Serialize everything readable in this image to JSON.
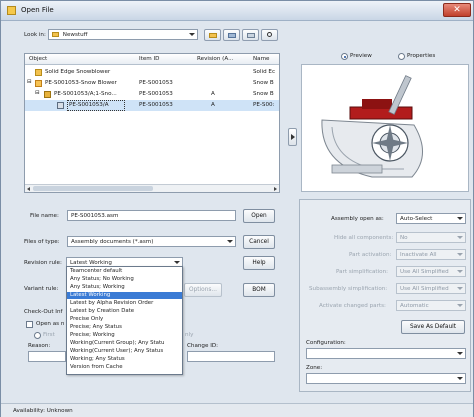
{
  "window": {
    "title": "Open File",
    "close_glyph": "✕"
  },
  "look_in": {
    "label": "Look in:",
    "value": "Newstuff"
  },
  "tree": {
    "columns": [
      "Object",
      "Item ID",
      "Revision (A...",
      "Name"
    ],
    "rows": [
      {
        "object": "Solid Edge Snowblower",
        "item_id": "",
        "revision": "",
        "name": "Solid Ec"
      },
      {
        "object": "PE-S001053-Snow Blower",
        "item_id": "PE-S001053",
        "revision": "",
        "name": "Snow B"
      },
      {
        "object": "PE-S001053/A;1-Sno...",
        "item_id": "PE-S001053",
        "revision": "A",
        "name": "Snow B"
      },
      {
        "object": "PE-S001053/A",
        "item_id": "PE-S001053",
        "revision": "A",
        "name": "PE-S00:"
      }
    ]
  },
  "view_mode": {
    "preview_label": "Preview",
    "properties_label": "Properties"
  },
  "file_name": {
    "label": "File name:",
    "value": "PE-S001053.asm",
    "open_button": "Open"
  },
  "files_of_type": {
    "label": "Files of type:",
    "value": "Assembly documents (*.asm)",
    "cancel_button": "Cancel"
  },
  "revision_rule": {
    "label": "Revision rule:",
    "value": "Latest Working",
    "help_button": "Help"
  },
  "variant_rule": {
    "label": "Variant rule:",
    "options_button": "Options...",
    "bom_button": "BOM"
  },
  "check_out": {
    "label": "Check-Out Inf",
    "open_as_label": "Open as n",
    "first_label": "First",
    "only_label": "nly",
    "reason_label": "Reason:",
    "change_id_label": "Change ID:"
  },
  "revision_rule_options": [
    "Teamcenter default",
    "Any Status; No Working",
    "Any Status; Working",
    "Latest Working",
    "Latest by Alpha Revision Order",
    "Latest by Creation Date",
    "Precise Only",
    "Precise; Any Status",
    "Precise; Working",
    "Working(Current Group); Any Statu",
    "Working(Current User); Any Status",
    "Working; Any Status",
    "Version from Cache"
  ],
  "assembly": {
    "open_as_label": "Assembly open as:",
    "open_as_value": "Auto-Select",
    "hide_components_label": "Hide all components:",
    "hide_components_value": "No",
    "part_activation_label": "Part activation:",
    "part_activation_value": "Inactivate All",
    "part_simplification_label": "Part simplification:",
    "part_simplification_value": "Use All Simplified",
    "subassembly_simplification_label": "Subassembly simplification:",
    "subassembly_simplification_value": "Use All Simplified",
    "activate_changed_label": "Activate changed parts:",
    "activate_changed_value": "Automatic",
    "save_default_button": "Save As Default",
    "configuration_label": "Configuration:",
    "zone_label": "Zone:"
  },
  "status": {
    "text": "Availability: Unknown"
  },
  "colors": {
    "selection": "#3a7bd5",
    "title_bar": "#c9d6e6",
    "close": "#c0402c"
  },
  "icons": [
    "folder-icon",
    "up-folder-icon",
    "new-folder-icon",
    "views-icon",
    "search-icon",
    "assembly-icon",
    "document-icon"
  ]
}
